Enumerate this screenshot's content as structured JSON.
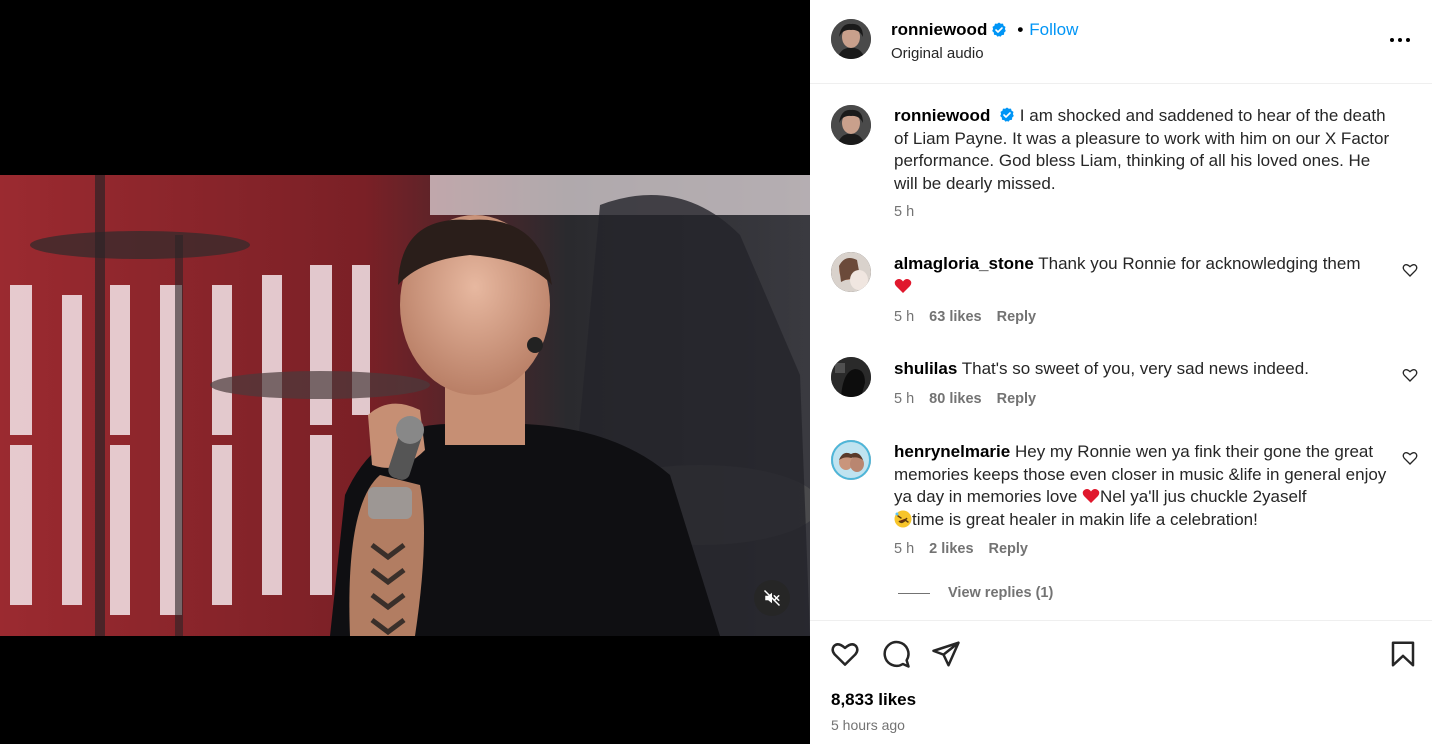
{
  "header": {
    "username": "ronniewood",
    "follow_label": "Follow",
    "subtitle": "Original audio",
    "dot": "•"
  },
  "caption": {
    "username": "ronniewood",
    "text": "I am shocked and saddened to hear of the death of Liam Payne. It was a pleasure to work with him on our X Factor performance. God bless Liam, thinking of all his loved ones. He will be dearly missed.",
    "time": "5 h"
  },
  "comments": [
    {
      "username": "almagloria_stone",
      "text": "Thank you Ronnie for acknowledging them",
      "time": "5 h",
      "likes": "63 likes",
      "reply": "Reply"
    },
    {
      "username": "shulilas",
      "text": "That's so sweet of you, very sad news indeed.",
      "time": "5 h",
      "likes": "80 likes",
      "reply": "Reply"
    },
    {
      "username": "henrynelmarie",
      "text_part1": "Hey my Ronnie wen ya fink their gone the great memories keeps those even closer in music &life in general enjoy ya day in memories love",
      "text_part2": "Nel ya'll jus chuckle 2yaself",
      "text_part3": "time is great healer in makin life a celebration!",
      "time": "5 h",
      "likes": "2 likes",
      "reply": "Reply"
    }
  ],
  "view_replies": "View replies (1)",
  "footer": {
    "likes": "8,833 likes",
    "time_ago": "5 hours ago"
  },
  "colors": {
    "accent": "#0095f6",
    "verified": "#0095f6",
    "muted": "#737373"
  }
}
